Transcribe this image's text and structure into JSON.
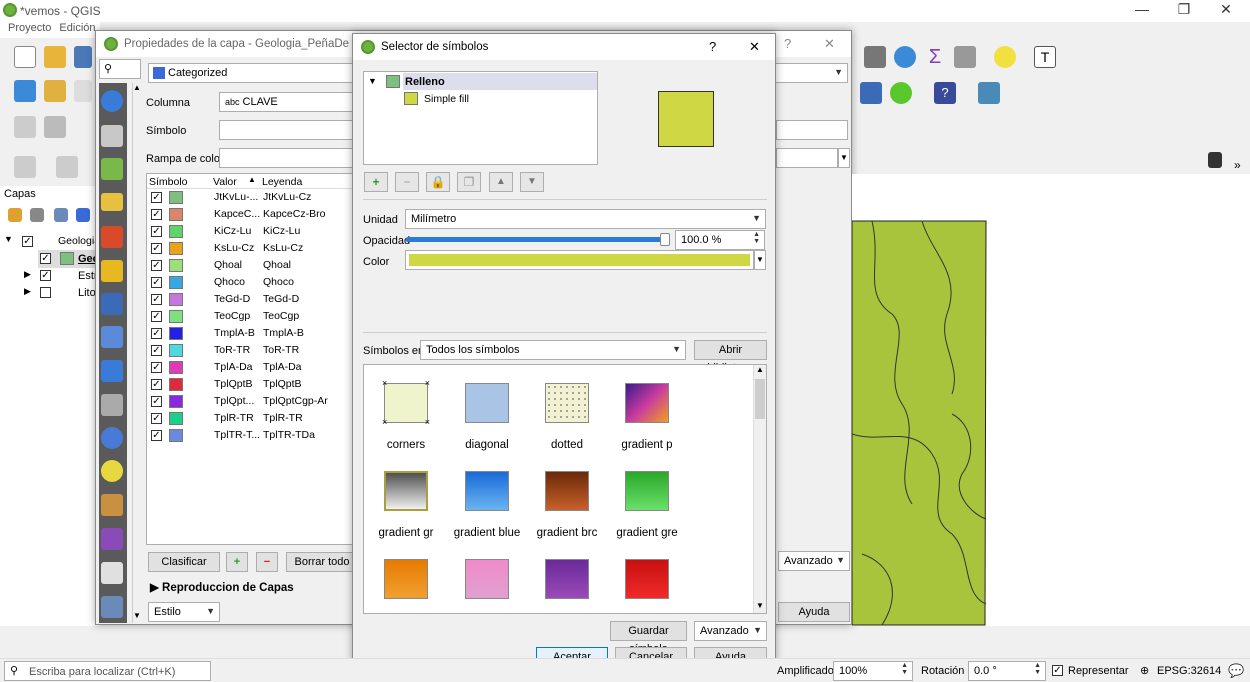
{
  "main_window": {
    "title": "*vemos - QGIS",
    "menu_items": [
      "Proyecto",
      "Edición"
    ],
    "layers_panel_title": "Capas",
    "layers": [
      {
        "name": "Geologia",
        "checked": true,
        "expanded": true
      },
      {
        "name": "Geo",
        "checked": true
      },
      {
        "name": "Estr",
        "checked": true
      },
      {
        "name": "Litol",
        "checked": false
      }
    ],
    "status_bar": {
      "locate_placeholder": "Escriba para localizar (Ctrl+K)",
      "magnifier_label": "Amplificador",
      "magnifier_value": "100%",
      "rotation_label": "Rotación",
      "rotation_value": "0.0 °",
      "render_label": "Representar",
      "crs": "EPSG:32614"
    },
    "toolbar_help_glyph": "?",
    "right_panel": {
      "advanced_label": "Avanzado",
      "help_label": "Ayuda"
    }
  },
  "layer_props": {
    "title": "Propiedades de la capa - Geologia_PeñaDe Bern",
    "search_placeholder": "",
    "renderer": "Categorized",
    "column_label": "Columna",
    "column_value": "CLAVE",
    "column_prefix": "abc",
    "symbol_label": "Símbolo",
    "ramp_label": "Rampa de color",
    "table_headers": {
      "symbol": "Símbolo",
      "value": "Valor",
      "legend": "Leyenda"
    },
    "categories": [
      {
        "value": "JtKvLu-...",
        "legend": "JtKvLu-Cz",
        "color": "#7fbf7f"
      },
      {
        "value": "KapceC...",
        "legend": "KapceCz-Bro",
        "color": "#d8876b"
      },
      {
        "value": "KiCz-Lu",
        "legend": "KiCz-Lu",
        "color": "#5fd46b"
      },
      {
        "value": "KsLu-Cz",
        "legend": "KsLu-Cz",
        "color": "#e8a31a"
      },
      {
        "value": "Qhoal",
        "legend": "Qhoal",
        "color": "#9de07a"
      },
      {
        "value": "Qhoco",
        "legend": "Qhoco",
        "color": "#3aa8e0"
      },
      {
        "value": "TeGd-D",
        "legend": "TeGd-D",
        "color": "#c475e0"
      },
      {
        "value": "TeoCgp",
        "legend": "TeoCgp",
        "color": "#7ee07e"
      },
      {
        "value": "TmplA-B",
        "legend": "TmplA-B",
        "color": "#2020e8"
      },
      {
        "value": "ToR-TR",
        "legend": "ToR-TR",
        "color": "#4fd8e0"
      },
      {
        "value": "TplA-Da",
        "legend": "TplA-Da",
        "color": "#e03ab8"
      },
      {
        "value": "TplQptB",
        "legend": "TplQptB",
        "color": "#e02a3a"
      },
      {
        "value": "TplQpt...",
        "legend": "TplQptCgp-Ar",
        "color": "#8a2ae0"
      },
      {
        "value": "TplR-TR",
        "legend": "TplR-TR",
        "color": "#1ad08a"
      },
      {
        "value": "TplTR-T...",
        "legend": "TplTR-TDa",
        "color": "#6a8ae0"
      }
    ],
    "classify_label": "Clasificar",
    "delete_all_label": "Borrar todo",
    "layer_rendering_label": "Reproduccion de Capas",
    "style_label": "Estilo"
  },
  "symbol_selector": {
    "title": "Selector de símbolos",
    "help_glyph": "?",
    "close_glyph": "✕",
    "tree_root": "Relleno",
    "tree_child": "Simple fill",
    "preview_color": "#cfd745",
    "unit_label": "Unidad",
    "unit_value": "Milímetro",
    "opacity_label": "Opacidad",
    "opacity_value": "100.0 %",
    "opacity_fraction": 1.0,
    "color_label": "Color",
    "fill_color": "#cfd745",
    "symbols_in_label": "Símbolos en",
    "symbols_in_value": "Todos los símbolos",
    "open_library_label": "Abrir biblioteca",
    "library": [
      {
        "name": "corners",
        "kind": "corners"
      },
      {
        "name": "diagonal",
        "kind": "diagonal"
      },
      {
        "name": "dotted",
        "kind": "dotted"
      },
      {
        "name": "gradient p",
        "kind": "gp"
      },
      {
        "name": "gradient gr",
        "kind": "ggray"
      },
      {
        "name": "gradient blue",
        "kind": "gblue"
      },
      {
        "name": "gradient brc",
        "kind": "gbrown"
      },
      {
        "name": "gradient gre",
        "kind": "ggreen"
      },
      {
        "name": "",
        "kind": "orange"
      },
      {
        "name": "",
        "kind": "pink"
      },
      {
        "name": "",
        "kind": "purple"
      },
      {
        "name": "",
        "kind": "red"
      }
    ],
    "save_symbol_label": "Guardar símbolo",
    "advanced_label": "Avanzado",
    "accept_label": "Aceptar",
    "cancel_label": "Cancelar",
    "help_label": "Ayuda"
  },
  "map": {
    "fill_color": "#a8c43c"
  }
}
